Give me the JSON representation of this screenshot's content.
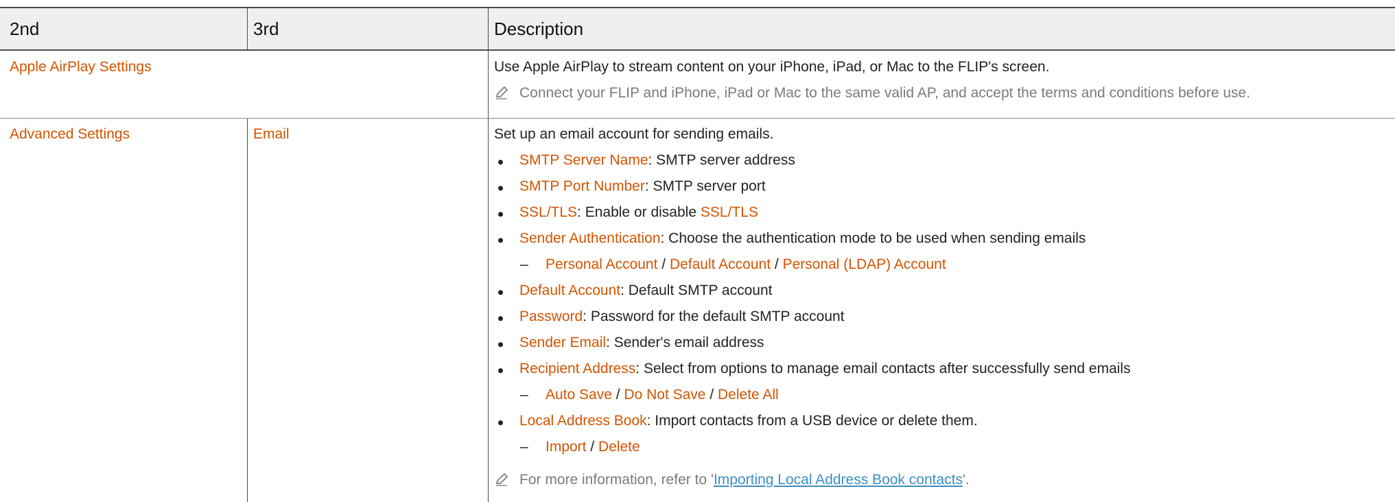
{
  "header": {
    "col2": "2nd",
    "col3": "3rd",
    "col_desc": "Description"
  },
  "row_airplay": {
    "name": "Apple AirPlay Settings",
    "desc": "Use Apple AirPlay to stream content on your iPhone, iPad, or Mac to the FLIP's screen.",
    "note": "Connect your FLIP and iPhone, iPad or Mac to the same valid AP, and accept the terms and conditions before use."
  },
  "row_advanced": {
    "name": "Advanced Settings",
    "sub": "Email",
    "intro": "Set up an email account for sending emails.",
    "items": [
      {
        "term": "SMTP Server Name",
        "sep": ": ",
        "text": "SMTP server address"
      },
      {
        "term": "SMTP Port Number",
        "sep": ": ",
        "text": "SMTP server port"
      },
      {
        "term": "SSL/TLS",
        "sep": ": ",
        "text": "Enable or disable ",
        "term2": "SSL/TLS"
      },
      {
        "term": "Sender Authentication",
        "sep": ": ",
        "text": "Choose the authentication mode to be used when sending emails"
      },
      {
        "term": "Default Account",
        "sep": ": ",
        "text": "Default SMTP account"
      },
      {
        "term": "Password",
        "sep": ": ",
        "text": "Password for the default SMTP account"
      },
      {
        "term": "Sender Email",
        "sep": ": ",
        "text": "Sender's email address"
      },
      {
        "term": "Recipient Address",
        "sep": ": ",
        "text": "Select from options to manage email contacts after successfully send emails"
      },
      {
        "term": "Local Address Book",
        "sep": ": ",
        "text": "Import contacts from a USB device or delete them."
      }
    ],
    "auth_options": [
      "Personal Account",
      "Default Account",
      "Personal (LDAP) Account"
    ],
    "recipient_options": [
      "Auto Save",
      "Do Not Save",
      "Delete All"
    ],
    "book_options": [
      "Import",
      "Delete"
    ],
    "slash": " / ",
    "dash": "–",
    "footnote_pre": "For more information, refer to '",
    "footnote_link": "Importing Local Address Book contacts",
    "footnote_post": "'."
  },
  "colors": {
    "accent": "#d35400",
    "note": "#7b7b7b",
    "link": "#3b8ec4",
    "header_bg": "#efefef"
  },
  "icons": {
    "note": "pencil-icon"
  }
}
